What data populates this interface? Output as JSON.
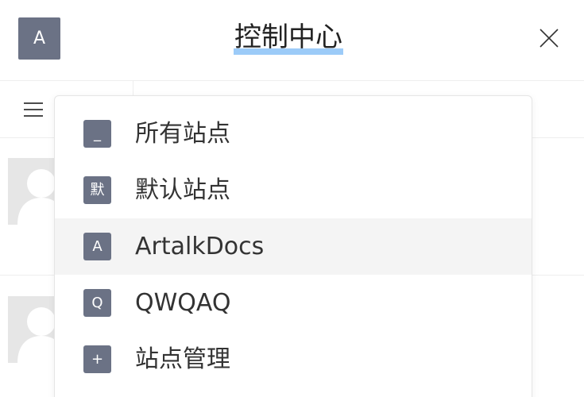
{
  "header": {
    "avatar_letter": "A",
    "title": "控制中心"
  },
  "site_menu": {
    "items": [
      {
        "icon_text": "_",
        "label": "所有站点"
      },
      {
        "icon_text": "默",
        "label": "默认站点"
      },
      {
        "icon_text": "A",
        "label": "ArtalkDocs"
      },
      {
        "icon_text": "Q",
        "label": "QWQAQ"
      },
      {
        "icon_text": "+",
        "label": "站点管理"
      }
    ]
  },
  "icons": {
    "close": "close-icon",
    "menu": "hamburger-menu-icon",
    "avatar_placeholder": "user-placeholder-icon"
  },
  "colors": {
    "site_icon_bg": "#6b7285",
    "active_item_bg": "#f4f4f4",
    "title_highlight": "#9ccbf8"
  }
}
